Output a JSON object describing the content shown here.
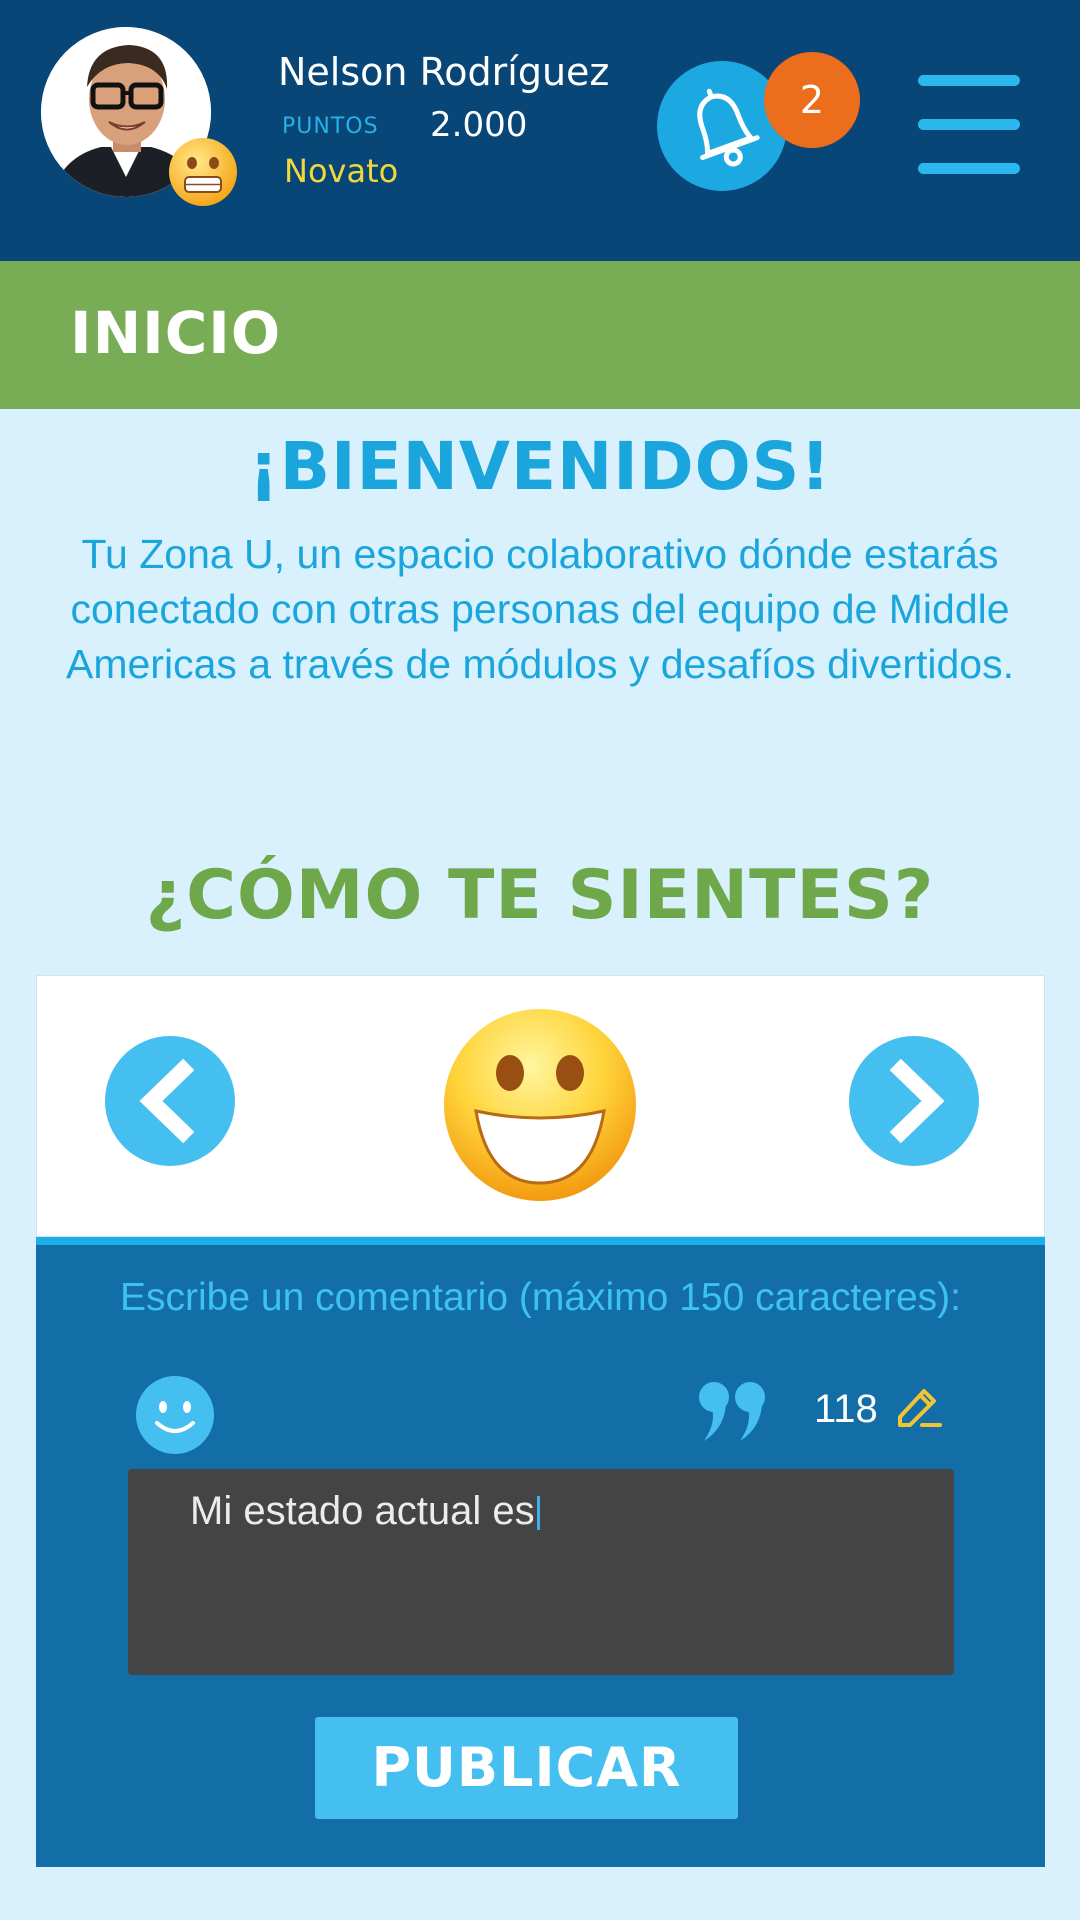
{
  "header": {
    "user_name": "Nelson Rodríguez",
    "points_label": "PUNTOS",
    "points_value": "2.000",
    "level": "Novato",
    "notifications_count": "2",
    "avatar_icon": "user-avatar-photo",
    "mood_badge_icon": "grimacing-face-icon",
    "bell_icon": "bell-icon",
    "menu_icon": "hamburger-menu-icon"
  },
  "section": {
    "title": "INICIO"
  },
  "welcome": {
    "title": "¡BIENVENIDOS!",
    "text": "Tu Zona U, un espacio colaborativo dónde estarás conectado con otras personas del equipo de Middle Americas a través de módulos y desafíos divertidos."
  },
  "mood": {
    "title": "¿CÓMO TE SIENTES?",
    "current_emoji": "grinning-face-icon",
    "prev_icon": "chevron-left-icon",
    "next_icon": "chevron-right-icon"
  },
  "comment": {
    "label": "Escribe un comentario (máximo 150 caracteres):",
    "char_count": "118",
    "input_value": "Mi estado actual es",
    "publish_label": "PUBLICAR",
    "emoji_icon": "smiley-icon",
    "quote_icon": "quote-icon",
    "pencil_icon": "pencil-icon"
  },
  "colors": {
    "header_bg": "#074677",
    "section_bg": "#78ad55",
    "page_bg": "#d9f1fc",
    "accent_blue": "#45bfef",
    "panel_bg": "#136ea7",
    "badge_orange": "#ec6d1c",
    "level_yellow": "#f0d83a"
  }
}
